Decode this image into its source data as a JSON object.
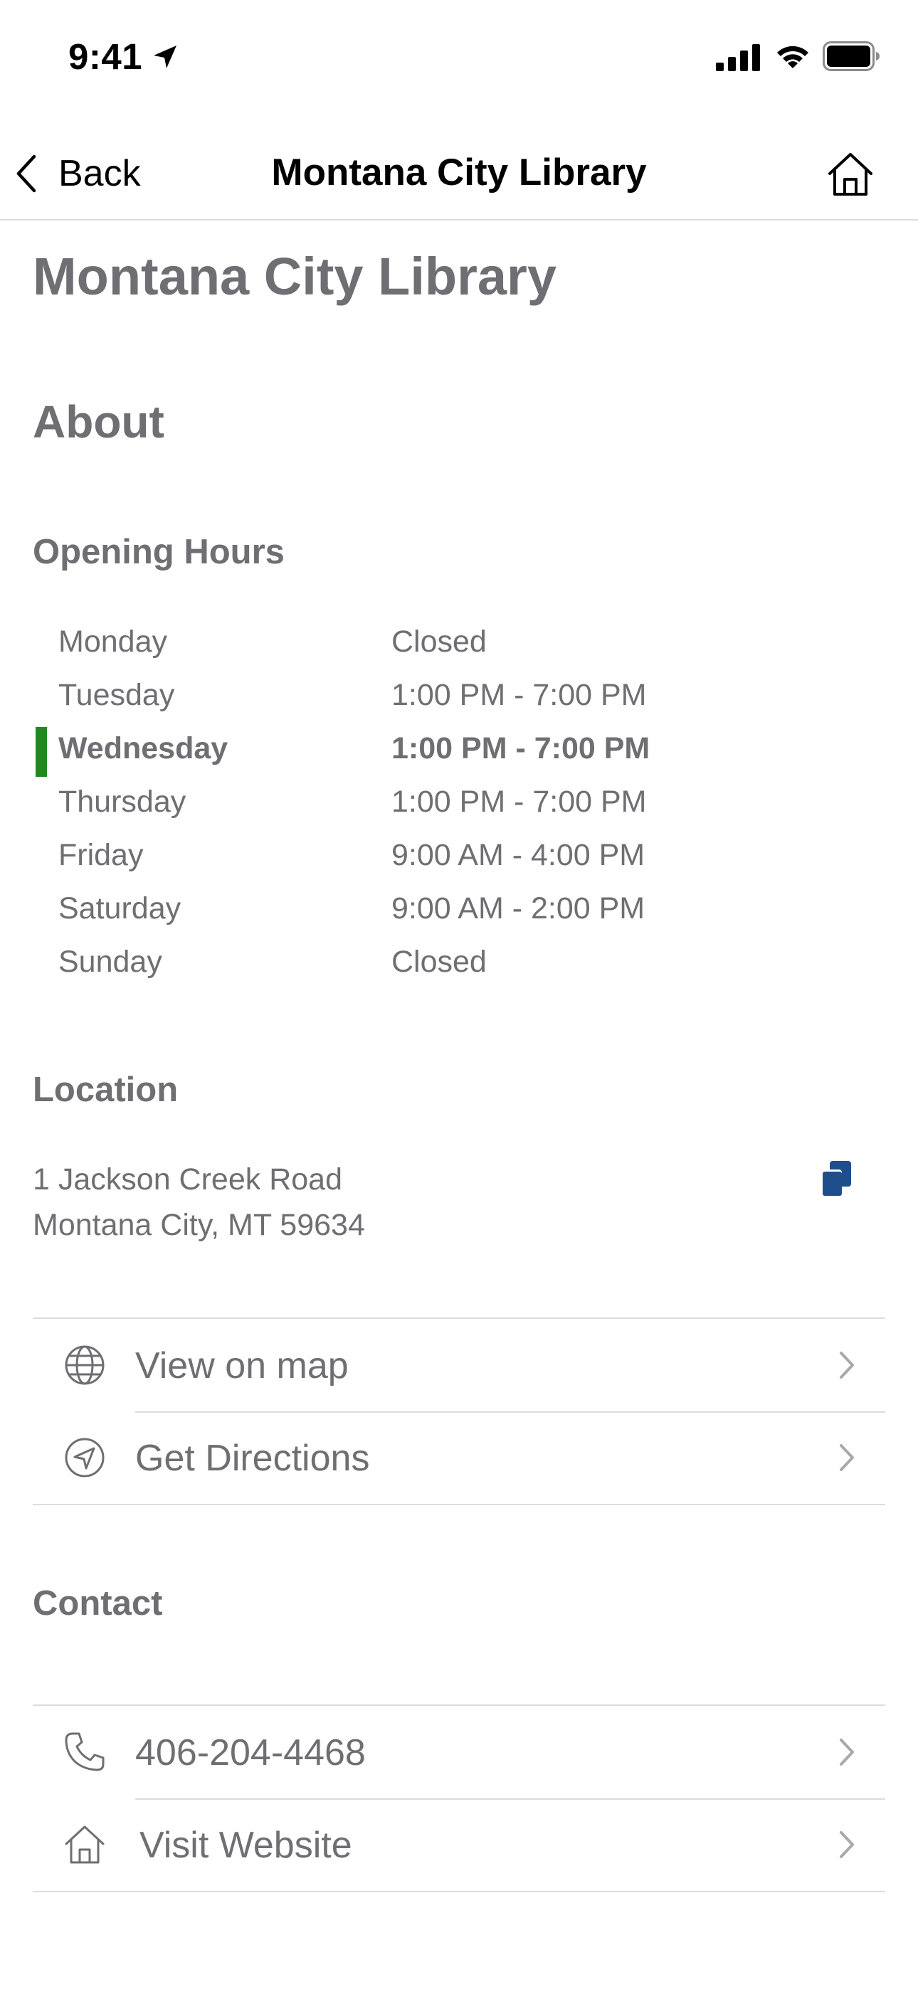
{
  "status_bar": {
    "time": "9:41"
  },
  "nav": {
    "back_label": "Back",
    "title": "Montana City Library"
  },
  "page": {
    "title": "Montana City Library"
  },
  "about": {
    "heading": "About",
    "opening_hours": {
      "heading": "Opening Hours",
      "today": "Wednesday",
      "rows": [
        {
          "day": "Monday",
          "time": "Closed"
        },
        {
          "day": "Tuesday",
          "time": "1:00 PM - 7:00 PM"
        },
        {
          "day": "Wednesday",
          "time": "1:00 PM - 7:00 PM"
        },
        {
          "day": "Thursday",
          "time": "1:00 PM - 7:00 PM"
        },
        {
          "day": "Friday",
          "time": "9:00 AM - 4:00 PM"
        },
        {
          "day": "Saturday",
          "time": "9:00 AM - 2:00 PM"
        },
        {
          "day": "Sunday",
          "time": "Closed"
        }
      ]
    },
    "location": {
      "heading": "Location",
      "address_line1": "1 Jackson Creek Road",
      "address_line2": "Montana City, MT 59634",
      "actions": [
        {
          "label": "View on map",
          "icon": "globe-icon"
        },
        {
          "label": "Get Directions",
          "icon": "navigation-icon"
        }
      ]
    },
    "contact": {
      "heading": "Contact",
      "actions": [
        {
          "label": "406-204-4468",
          "icon": "phone-icon"
        },
        {
          "label": "Visit Website",
          "icon": "home-icon"
        }
      ]
    }
  },
  "colors": {
    "text_secondary": "#6e6e73",
    "today_marker": "#1e8a1e",
    "copy_icon": "#1f4e8c",
    "separator": "#dcdce0"
  }
}
